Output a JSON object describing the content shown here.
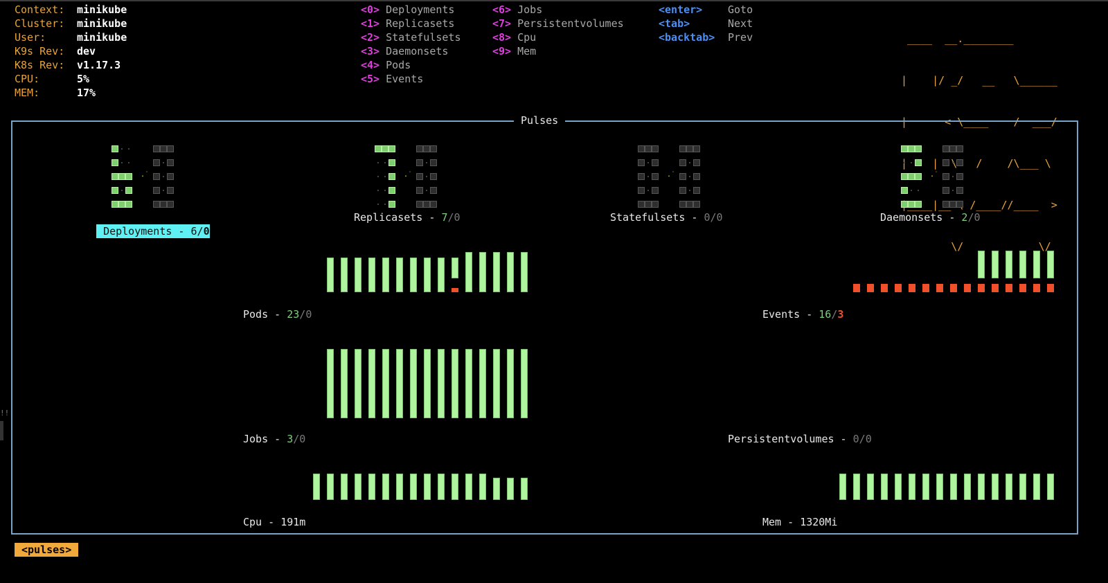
{
  "header": {
    "info": [
      {
        "label": "Context:",
        "value": "minikube"
      },
      {
        "label": "Cluster:",
        "value": "minikube"
      },
      {
        "label": "User:",
        "value": "minikube"
      },
      {
        "label": "K9s Rev:",
        "value": "dev"
      },
      {
        "label": "K8s Rev:",
        "value": "v1.17.3"
      },
      {
        "label": "CPU:",
        "value": "5%"
      },
      {
        "label": "MEM:",
        "value": "17%"
      }
    ],
    "menu_col1": [
      {
        "key": "<0>",
        "label": "Deployments"
      },
      {
        "key": "<1>",
        "label": "Replicasets"
      },
      {
        "key": "<2>",
        "label": "Statefulsets"
      },
      {
        "key": "<3>",
        "label": "Daemonsets"
      },
      {
        "key": "<4>",
        "label": "Pods"
      },
      {
        "key": "<5>",
        "label": "Events"
      }
    ],
    "menu_col2": [
      {
        "key": "<6>",
        "label": "Jobs"
      },
      {
        "key": "<7>",
        "label": "Persistentvolumes"
      },
      {
        "key": "<8>",
        "label": "Cpu"
      },
      {
        "key": "<9>",
        "label": "Mem"
      }
    ],
    "nav_keys": [
      {
        "key": "<enter>",
        "label": "Goto"
      },
      {
        "key": "<tab>",
        "label": "Next"
      },
      {
        "key": "<backtab>",
        "label": "Prev"
      }
    ],
    "logo_lines": [
      " ____  __.________       ",
      "|    |/ _/   __   \\______",
      "|      < \\____    /  ___/",
      "|    |  \\   /    /\\___ \\ ",
      "|____|__ \\ /____//____  >",
      "        \\/            \\/ "
    ]
  },
  "pulses": {
    "title": "Pulses",
    "gauges": [
      {
        "name": "Deployments",
        "ok": "6",
        "fault": "0",
        "selected": true
      },
      {
        "name": "Replicasets",
        "ok": "7",
        "fault": "0",
        "selected": false
      },
      {
        "name": "Statefulsets",
        "ok": "0",
        "fault": "0",
        "selected": false
      },
      {
        "name": "Daemonsets",
        "ok": "2",
        "fault": "0",
        "selected": false
      }
    ],
    "sparklines": [
      {
        "name": "Pods",
        "ok": "23",
        "fault": "0",
        "ok_series": [
          0.83,
          0.83,
          0.83,
          0.83,
          0.83,
          0.83,
          0.83,
          0.83,
          0.83,
          0.5,
          0.97,
          0.97,
          0.97,
          0.97,
          0.97
        ],
        "fault_series": [
          0,
          0,
          0,
          0,
          0,
          0,
          0,
          0,
          0,
          0.1,
          0,
          0,
          0,
          0,
          0
        ]
      },
      {
        "name": "Events",
        "ok": "16",
        "fault": "3",
        "ok_series": [
          0,
          0,
          0,
          0,
          0,
          0,
          0,
          0,
          0,
          1,
          1,
          1,
          1,
          1,
          1
        ],
        "fault_series": [
          1,
          1,
          1,
          1,
          1,
          1,
          1,
          1,
          1,
          1,
          1,
          1,
          1,
          1,
          1
        ]
      },
      {
        "name": "Jobs",
        "ok": "3",
        "fault": "0",
        "ok_series": [
          1,
          1,
          1,
          1,
          1,
          1,
          1,
          1,
          1,
          1,
          1,
          1,
          1,
          1,
          1
        ]
      },
      {
        "name": "Persistentvolumes",
        "ok": "0",
        "fault": "0",
        "ok_series": []
      },
      {
        "name": "Cpu",
        "value": "191m",
        "ok_series": [
          1,
          1,
          1,
          1,
          1,
          1,
          1,
          1,
          1,
          1,
          1,
          1,
          1,
          0.84,
          0.84,
          0.84
        ]
      },
      {
        "name": "Mem",
        "value": "1320Mi",
        "ok_series": [
          1,
          1,
          1,
          1,
          1,
          1,
          1,
          1,
          1,
          1,
          1,
          1,
          1,
          1,
          1,
          1
        ]
      }
    ]
  },
  "crumb": "<pulses>",
  "colors": {
    "ok": "#aef59e",
    "fault": "#f0502a",
    "accent": "#e8a33a",
    "frame": "#7aa3c8"
  }
}
